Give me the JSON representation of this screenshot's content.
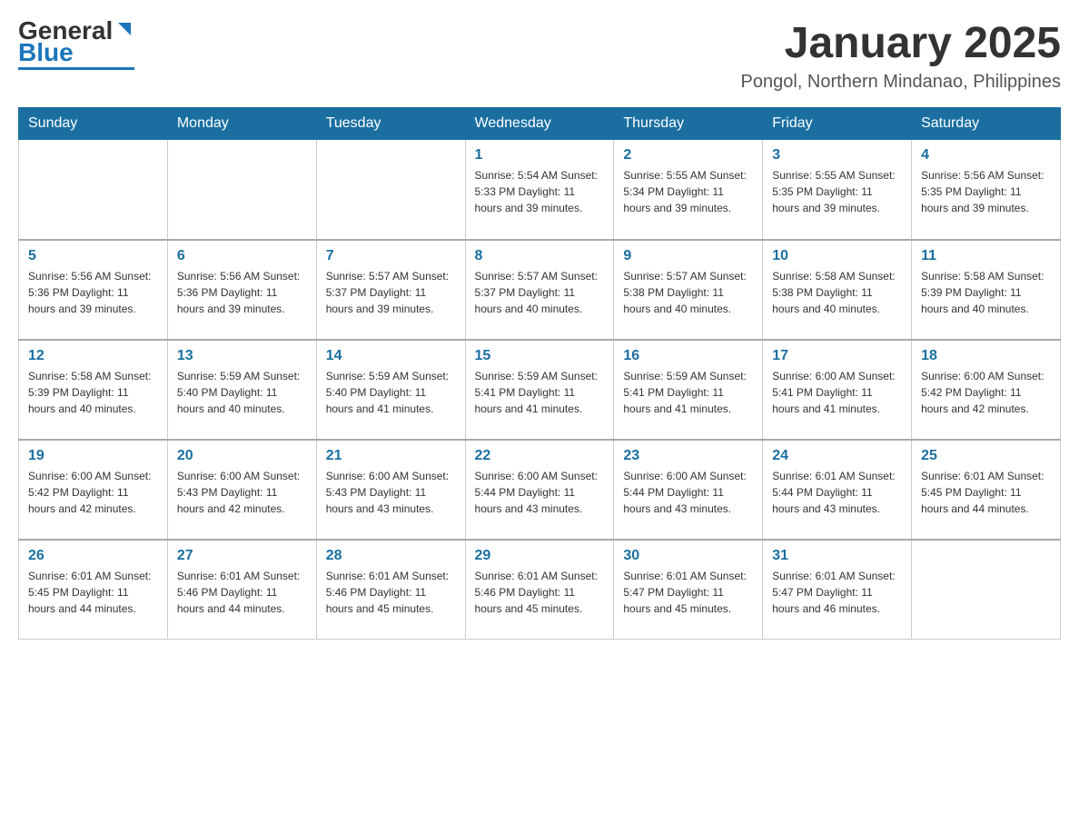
{
  "header": {
    "logo_general": "General",
    "logo_blue": "Blue",
    "month_title": "January 2025",
    "location": "Pongol, Northern Mindanao, Philippines"
  },
  "days_of_week": [
    "Sunday",
    "Monday",
    "Tuesday",
    "Wednesday",
    "Thursday",
    "Friday",
    "Saturday"
  ],
  "weeks": [
    [
      {
        "day": "",
        "info": ""
      },
      {
        "day": "",
        "info": ""
      },
      {
        "day": "",
        "info": ""
      },
      {
        "day": "1",
        "info": "Sunrise: 5:54 AM\nSunset: 5:33 PM\nDaylight: 11 hours and 39 minutes."
      },
      {
        "day": "2",
        "info": "Sunrise: 5:55 AM\nSunset: 5:34 PM\nDaylight: 11 hours and 39 minutes."
      },
      {
        "day": "3",
        "info": "Sunrise: 5:55 AM\nSunset: 5:35 PM\nDaylight: 11 hours and 39 minutes."
      },
      {
        "day": "4",
        "info": "Sunrise: 5:56 AM\nSunset: 5:35 PM\nDaylight: 11 hours and 39 minutes."
      }
    ],
    [
      {
        "day": "5",
        "info": "Sunrise: 5:56 AM\nSunset: 5:36 PM\nDaylight: 11 hours and 39 minutes."
      },
      {
        "day": "6",
        "info": "Sunrise: 5:56 AM\nSunset: 5:36 PM\nDaylight: 11 hours and 39 minutes."
      },
      {
        "day": "7",
        "info": "Sunrise: 5:57 AM\nSunset: 5:37 PM\nDaylight: 11 hours and 39 minutes."
      },
      {
        "day": "8",
        "info": "Sunrise: 5:57 AM\nSunset: 5:37 PM\nDaylight: 11 hours and 40 minutes."
      },
      {
        "day": "9",
        "info": "Sunrise: 5:57 AM\nSunset: 5:38 PM\nDaylight: 11 hours and 40 minutes."
      },
      {
        "day": "10",
        "info": "Sunrise: 5:58 AM\nSunset: 5:38 PM\nDaylight: 11 hours and 40 minutes."
      },
      {
        "day": "11",
        "info": "Sunrise: 5:58 AM\nSunset: 5:39 PM\nDaylight: 11 hours and 40 minutes."
      }
    ],
    [
      {
        "day": "12",
        "info": "Sunrise: 5:58 AM\nSunset: 5:39 PM\nDaylight: 11 hours and 40 minutes."
      },
      {
        "day": "13",
        "info": "Sunrise: 5:59 AM\nSunset: 5:40 PM\nDaylight: 11 hours and 40 minutes."
      },
      {
        "day": "14",
        "info": "Sunrise: 5:59 AM\nSunset: 5:40 PM\nDaylight: 11 hours and 41 minutes."
      },
      {
        "day": "15",
        "info": "Sunrise: 5:59 AM\nSunset: 5:41 PM\nDaylight: 11 hours and 41 minutes."
      },
      {
        "day": "16",
        "info": "Sunrise: 5:59 AM\nSunset: 5:41 PM\nDaylight: 11 hours and 41 minutes."
      },
      {
        "day": "17",
        "info": "Sunrise: 6:00 AM\nSunset: 5:41 PM\nDaylight: 11 hours and 41 minutes."
      },
      {
        "day": "18",
        "info": "Sunrise: 6:00 AM\nSunset: 5:42 PM\nDaylight: 11 hours and 42 minutes."
      }
    ],
    [
      {
        "day": "19",
        "info": "Sunrise: 6:00 AM\nSunset: 5:42 PM\nDaylight: 11 hours and 42 minutes."
      },
      {
        "day": "20",
        "info": "Sunrise: 6:00 AM\nSunset: 5:43 PM\nDaylight: 11 hours and 42 minutes."
      },
      {
        "day": "21",
        "info": "Sunrise: 6:00 AM\nSunset: 5:43 PM\nDaylight: 11 hours and 43 minutes."
      },
      {
        "day": "22",
        "info": "Sunrise: 6:00 AM\nSunset: 5:44 PM\nDaylight: 11 hours and 43 minutes."
      },
      {
        "day": "23",
        "info": "Sunrise: 6:00 AM\nSunset: 5:44 PM\nDaylight: 11 hours and 43 minutes."
      },
      {
        "day": "24",
        "info": "Sunrise: 6:01 AM\nSunset: 5:44 PM\nDaylight: 11 hours and 43 minutes."
      },
      {
        "day": "25",
        "info": "Sunrise: 6:01 AM\nSunset: 5:45 PM\nDaylight: 11 hours and 44 minutes."
      }
    ],
    [
      {
        "day": "26",
        "info": "Sunrise: 6:01 AM\nSunset: 5:45 PM\nDaylight: 11 hours and 44 minutes."
      },
      {
        "day": "27",
        "info": "Sunrise: 6:01 AM\nSunset: 5:46 PM\nDaylight: 11 hours and 44 minutes."
      },
      {
        "day": "28",
        "info": "Sunrise: 6:01 AM\nSunset: 5:46 PM\nDaylight: 11 hours and 45 minutes."
      },
      {
        "day": "29",
        "info": "Sunrise: 6:01 AM\nSunset: 5:46 PM\nDaylight: 11 hours and 45 minutes."
      },
      {
        "day": "30",
        "info": "Sunrise: 6:01 AM\nSunset: 5:47 PM\nDaylight: 11 hours and 45 minutes."
      },
      {
        "day": "31",
        "info": "Sunrise: 6:01 AM\nSunset: 5:47 PM\nDaylight: 11 hours and 46 minutes."
      },
      {
        "day": "",
        "info": ""
      }
    ]
  ]
}
